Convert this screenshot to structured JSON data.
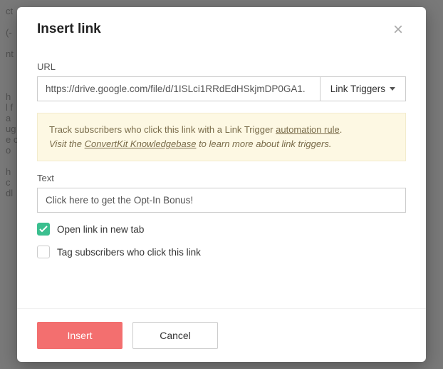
{
  "modal": {
    "title": "Insert link",
    "url_label": "URL",
    "url_value": "https://drive.google.com/file/d/1ISLci1RRdEdHSkjmDP0GA1.",
    "link_triggers_label": "Link Triggers",
    "info": {
      "line1_prefix": "Track subscribers who click this link with a Link Trigger ",
      "line1_link": "automation rule",
      "line1_suffix": ".",
      "line2_prefix": "Visit the ",
      "line2_link": "ConvertKit Knowledgebase",
      "line2_suffix": " to learn more about link triggers."
    },
    "text_label": "Text",
    "text_value": "Click here to get the Opt-In Bonus!",
    "open_new_tab_label": "Open link in new tab",
    "open_new_tab_checked": true,
    "tag_subs_label": "Tag subscribers who click this link",
    "tag_subs_checked": false,
    "insert_label": "Insert",
    "cancel_label": "Cancel"
  }
}
